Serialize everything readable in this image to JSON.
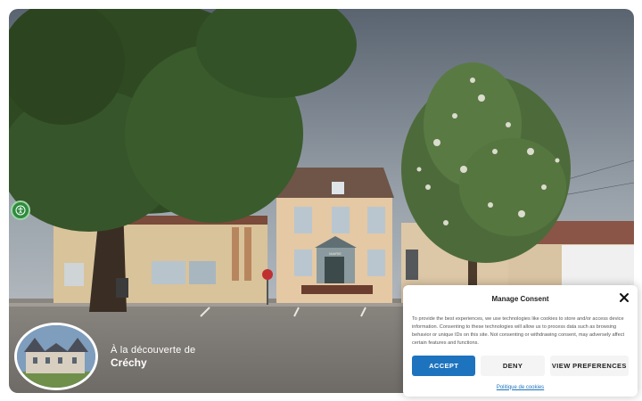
{
  "hero": {
    "subtitle": "À la découverte de",
    "town_name": "Créchy",
    "sign_text": "MAIRIE"
  },
  "accessibility": {
    "icon": "accessibility-icon"
  },
  "consent": {
    "title": "Manage Consent",
    "body": "To provide the best experiences, we use technologies like cookies to store and/or access device information. Consenting to these technologies will allow us to process data such as browsing behavior or unique IDs on this site. Not consenting or withdrawing consent, may adversely affect certain features and functions.",
    "accept_label": "ACCEPT",
    "deny_label": "DENY",
    "preferences_label": "VIEW PREFERENCES",
    "policy_link": "Politique de cookies",
    "colors": {
      "accent": "#1e73be",
      "secondary_button": "#f4f4f4"
    }
  }
}
